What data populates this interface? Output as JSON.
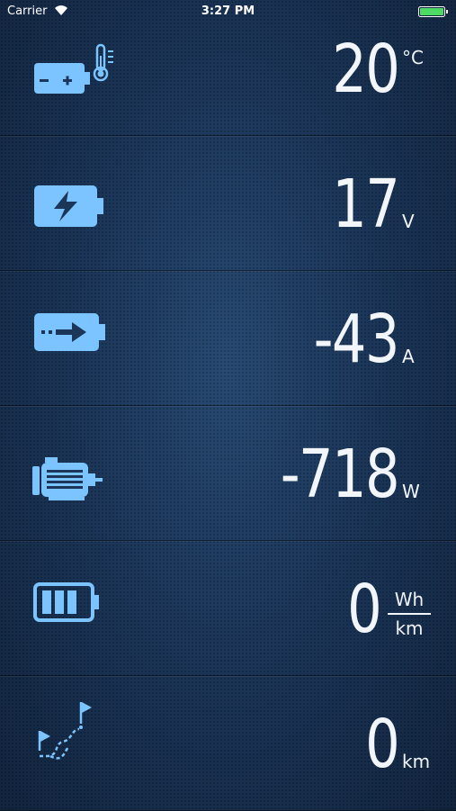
{
  "status_bar": {
    "carrier": "Carrier",
    "time": "3:27 PM"
  },
  "colors": {
    "icon": "#7cc4ff",
    "text": "#f2f5f9",
    "battery": "#4cd964"
  },
  "readings": [
    {
      "icon": "battery-temperature-icon",
      "value": "20",
      "unit": "°C"
    },
    {
      "icon": "battery-charge-icon",
      "value": "17",
      "unit": "V"
    },
    {
      "icon": "battery-current-icon",
      "value": "-43",
      "unit": "A"
    },
    {
      "icon": "motor-icon",
      "value": "-718",
      "unit": "W"
    },
    {
      "icon": "battery-level-icon",
      "value": "0",
      "unit_top": "Wh",
      "unit_bottom": "km"
    },
    {
      "icon": "route-icon",
      "value": "0",
      "unit": "km"
    }
  ]
}
